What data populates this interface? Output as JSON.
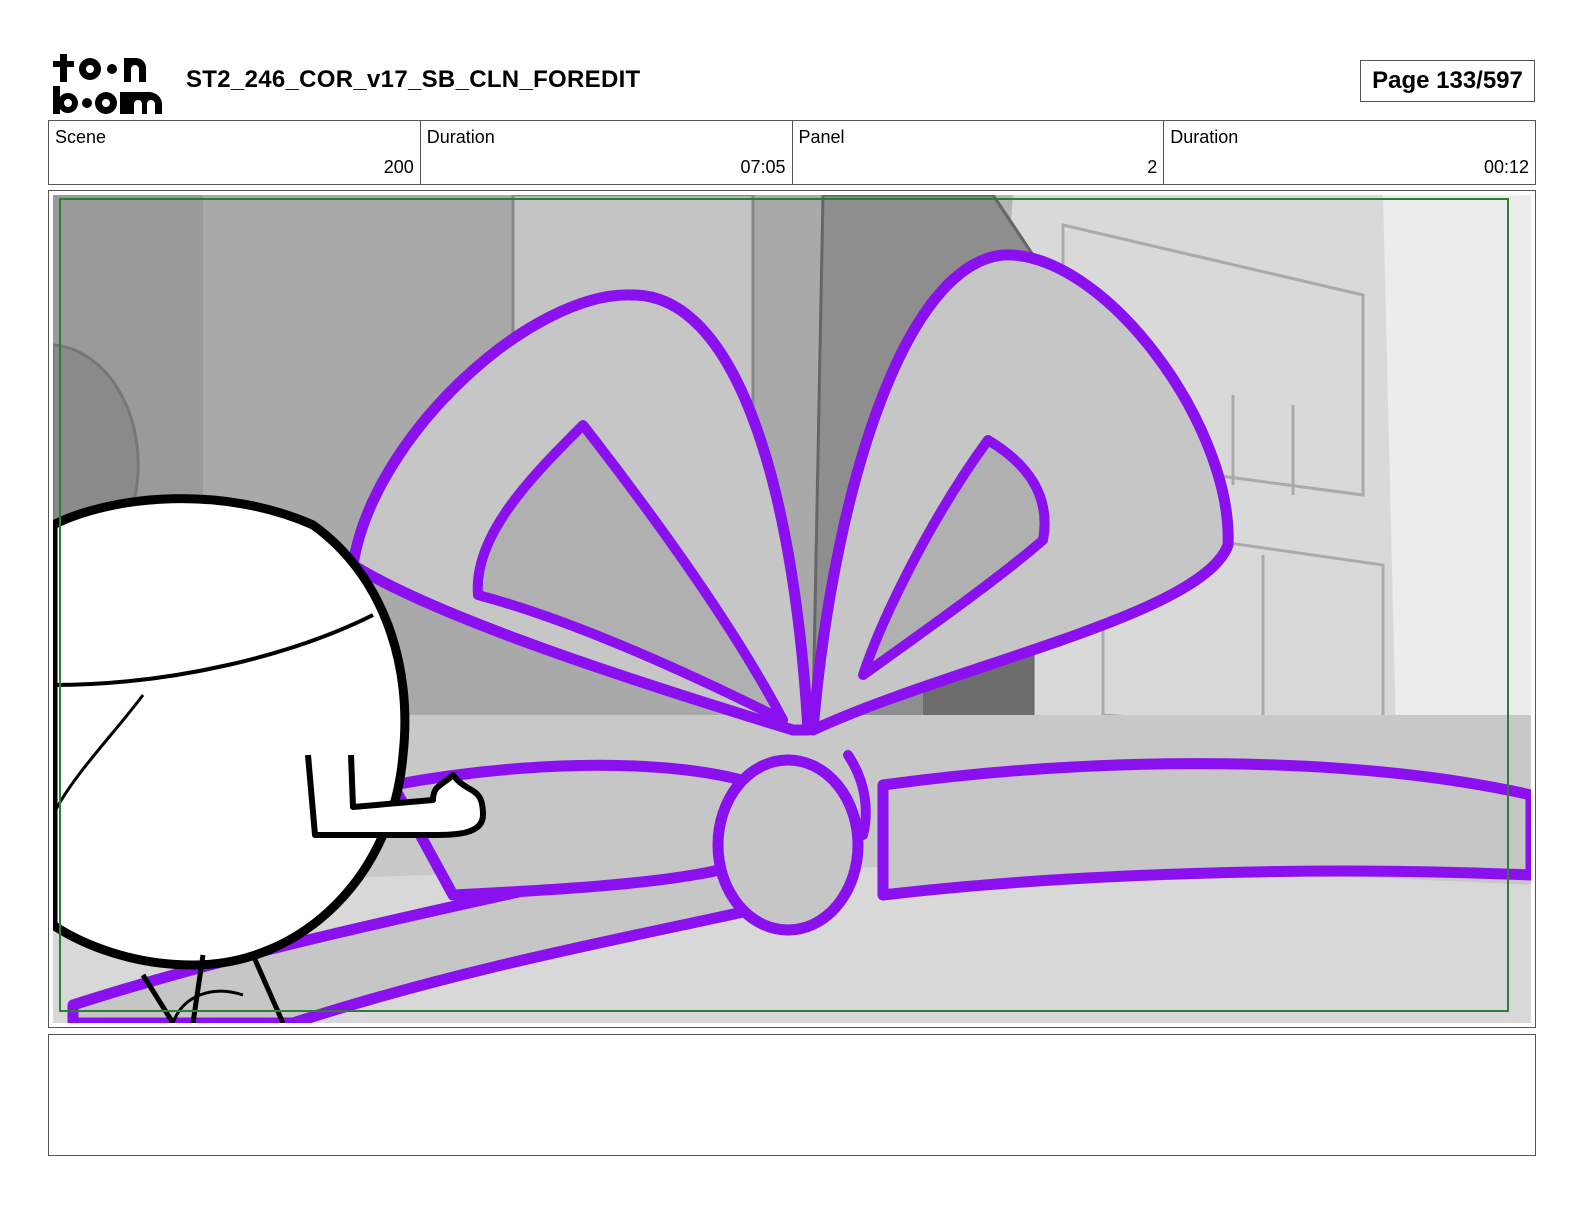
{
  "header": {
    "logo": {
      "line1": "toon",
      "line2": "boom"
    },
    "title": "ST2_246_COR_v17_SB_CLN_FOREDIT",
    "page": "Page 133/597"
  },
  "info": [
    {
      "label": "Scene",
      "value": "200"
    },
    {
      "label": "Duration",
      "value": "07:05"
    },
    {
      "label": "Panel",
      "value": "2"
    },
    {
      "label": "Duration",
      "value": "00:12"
    }
  ],
  "colors": {
    "ribbon": "#8a10f0",
    "safe_frame": "#2e7d32",
    "background_gray": "#b9b9b9",
    "border": "#555555"
  },
  "notes": {
    "text": ""
  }
}
